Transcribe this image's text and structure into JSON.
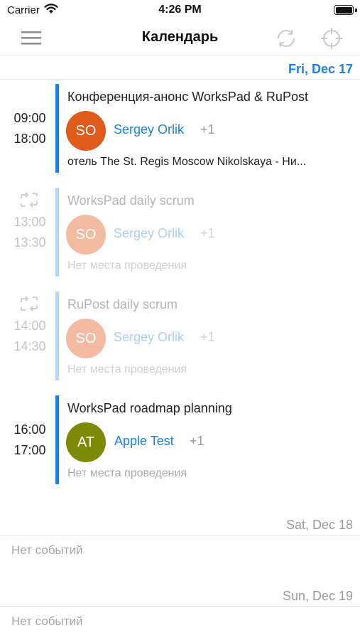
{
  "status_bar": {
    "carrier": "Carrier",
    "time": "4:26 PM"
  },
  "nav": {
    "title": "Календарь",
    "menu_icon": "hamburger-menu-icon",
    "sync_icon": "sync-icon",
    "locate_icon": "crosshair-icon"
  },
  "colors": {
    "accent": "#1a7fe8",
    "accent_faded": "#b5d6f8",
    "avatar_so": "#e05a1a",
    "avatar_so_faded": "#f3bca2",
    "avatar_at": "#7d8a07"
  },
  "days": [
    {
      "date": "Fri, Dec 17",
      "events": [
        {
          "start": "09:00",
          "end": "18:00",
          "title": "Конференция-анонс WorksPad & RuPost",
          "avatar_initials": "SO",
          "organizer": "Sergey Orlik",
          "extra": "+1",
          "location": "отель The St. Regis Moscow Nikolskaya - Ни...",
          "recurring": false
        },
        {
          "start": "13:00",
          "end": "13:30",
          "title": "WorksPad daily scrum",
          "avatar_initials": "SO",
          "organizer": "Sergey Orlik",
          "extra": "+1",
          "location": "Нет места проведения",
          "recurring": true
        },
        {
          "start": "14:00",
          "end": "14:30",
          "title": "RuPost daily scrum",
          "avatar_initials": "SO",
          "organizer": "Sergey Orlik",
          "extra": "+1",
          "location": "Нет места проведения",
          "recurring": true
        },
        {
          "start": "16:00",
          "end": "17:00",
          "title": "WorksPad roadmap planning",
          "avatar_initials": "AT",
          "organizer": "Apple Test",
          "extra": "+1",
          "location": "Нет места проведения",
          "recurring": false
        }
      ]
    },
    {
      "date": "Sat, Dec 18",
      "empty_text": "Нет событий"
    },
    {
      "date": "Sun, Dec 19",
      "empty_text": "Нет событий"
    }
  ]
}
